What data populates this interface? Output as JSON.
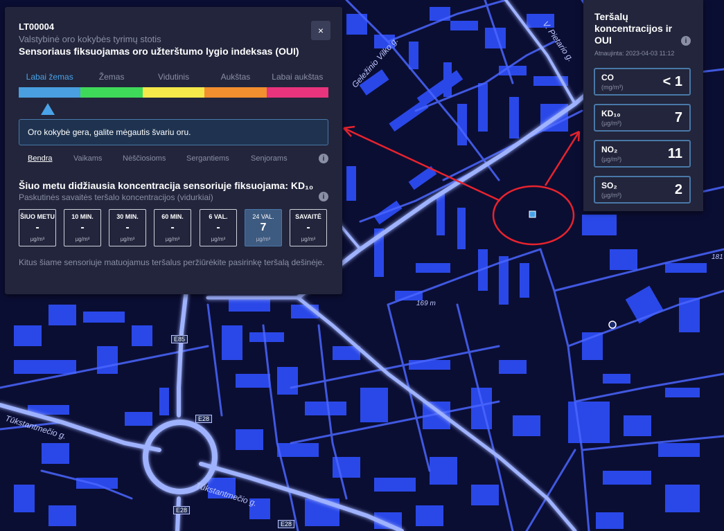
{
  "station": {
    "id": "LT00004",
    "type": "Valstybinė oro kokybės tyrimų stotis",
    "title": "Sensoriaus fiksuojamas oro užterštumo lygio indeksas (OUI)",
    "close_label": "×"
  },
  "levels": [
    "Labai žemas",
    "Žemas",
    "Vidutinis",
    "Aukštas",
    "Labai aukštas"
  ],
  "active_level": "Labai žemas",
  "level_colors": [
    "#4a9fe0",
    "#3fd95a",
    "#f4e84a",
    "#f28f2e",
    "#e8347c"
  ],
  "message": "Oro kokybė gera, galite mėgautis švariu oru.",
  "tabs": [
    "Bendra",
    "Vaikams",
    "Nėščiosioms",
    "Sergantiems",
    "Senjorams"
  ],
  "active_tab": "Bendra",
  "concentration": {
    "title": "Šiuo metu didžiausia koncentracija sensoriuje fiksuojama: KD₁₀",
    "subtitle": "Paskutinės savaitės teršalo koncentracijos (vidurkiai)",
    "unit": "µg/m³",
    "boxes": [
      {
        "label": "ŠIUO METU",
        "value": "-"
      },
      {
        "label": "10 MIN.",
        "value": "-"
      },
      {
        "label": "30 MIN.",
        "value": "-"
      },
      {
        "label": "60 MIN.",
        "value": "-"
      },
      {
        "label": "6 VAL.",
        "value": "-"
      },
      {
        "label": "24 VAL.",
        "value": "7"
      },
      {
        "label": "SAVAITĖ",
        "value": "-"
      }
    ],
    "active_box": "24 VAL."
  },
  "footer_text": "Kitus šiame sensoriuje matuojamus teršalus peržiūrėkite pasirinkę teršalą dešinėje.",
  "right_panel": {
    "title": "Teršalų koncentracijos ir OUI",
    "updated": "Atnaujinta: 2023-04-03 11:12",
    "pollutants": [
      {
        "name": "CO",
        "unit": "(mg/m³)",
        "value": "< 1"
      },
      {
        "name": "KD₁₀",
        "unit": "(µg/m³)",
        "value": "7"
      },
      {
        "name": "NO₂",
        "unit": "(µg/m³)",
        "value": "11"
      },
      {
        "name": "SO₂",
        "unit": "(µg/m³)",
        "value": "2"
      }
    ]
  },
  "map": {
    "streets": [
      "Geležinio Vilko g.",
      "V. Pietario g.",
      "Tūkstantmečio g.",
      "Tūkstantmečio g."
    ],
    "routes": [
      "E85",
      "E28",
      "E28",
      "E28"
    ],
    "distance": "169 m",
    "edge_label": "181"
  },
  "colors": {
    "map_background": "#0b0e33",
    "buildings": "#2a48e8",
    "roads": "#5a78ff",
    "annotation": "#e8232e",
    "sensor": "#4aa3e8"
  },
  "icons": {
    "info": "info-icon",
    "close": "close-icon",
    "sensor": "sensor-square-icon",
    "station": "station-dot-icon"
  }
}
